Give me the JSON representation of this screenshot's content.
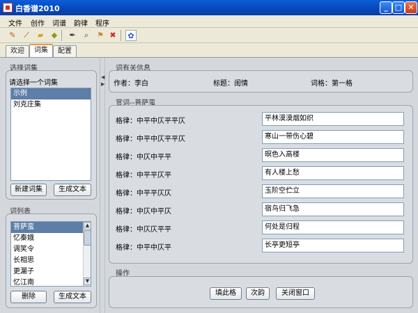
{
  "window": {
    "title": "白香谱2010"
  },
  "menu": [
    "文件",
    "创作",
    "词谱",
    "韵律",
    "程序"
  ],
  "toolbar": {
    "icons": [
      "pencil-icon",
      "brush-icon",
      "folder-open-icon",
      "tag-icon",
      "pen-nib-icon",
      "magnifier-icon",
      "flag-icon",
      "delete-x-icon",
      "paw-icon"
    ]
  },
  "tabs": [
    "欢迎",
    "词集",
    "配置"
  ],
  "left": {
    "select_collection": {
      "group_title": "选择词集",
      "prompt": "请选择一个词集",
      "items": [
        "示例",
        "刘克庄集"
      ],
      "selected_index": 0,
      "new_button": "新建词集",
      "generate_button": "生成文本"
    },
    "ci_list": {
      "group_title": "词列表",
      "items": [
        "菩萨蛮",
        "忆秦娥",
        "调笑令",
        "长相思",
        "更漏子",
        "忆江南"
      ],
      "selected_index": 0,
      "delete_button": "删除",
      "generate_button": "生成文本"
    }
  },
  "right": {
    "info": {
      "group_title": "词有关信息",
      "author": "作者：李白",
      "title": "标题：闺情",
      "form": "词格：第一格"
    },
    "appreciate": {
      "group_title": "赏词--菩萨蛮",
      "rows": [
        {
          "rule": "格律：中平中仄平平仄",
          "text": "平林漠漠烟如织"
        },
        {
          "rule": "格律：中平中仄平平仄",
          "text": "寒山一带伤心碧"
        },
        {
          "rule": "格律：中仄中平平",
          "text": "暝色入高楼"
        },
        {
          "rule": "格律：中平平仄平",
          "text": "有人楼上愁"
        },
        {
          "rule": "格律：中平平仄仄",
          "text": "玉阶空伫立"
        },
        {
          "rule": "格律：中仄中平仄",
          "text": "宿鸟归飞急"
        },
        {
          "rule": "格律：中仄仄平平",
          "text": "何处是归程"
        },
        {
          "rule": "格律：中平中仄平",
          "text": "长亭更短亭"
        }
      ]
    },
    "ops": {
      "group_title": "操作",
      "fill_button": "填此格",
      "rhyme_button": "次韵",
      "close_button": "关闭窗口"
    }
  }
}
